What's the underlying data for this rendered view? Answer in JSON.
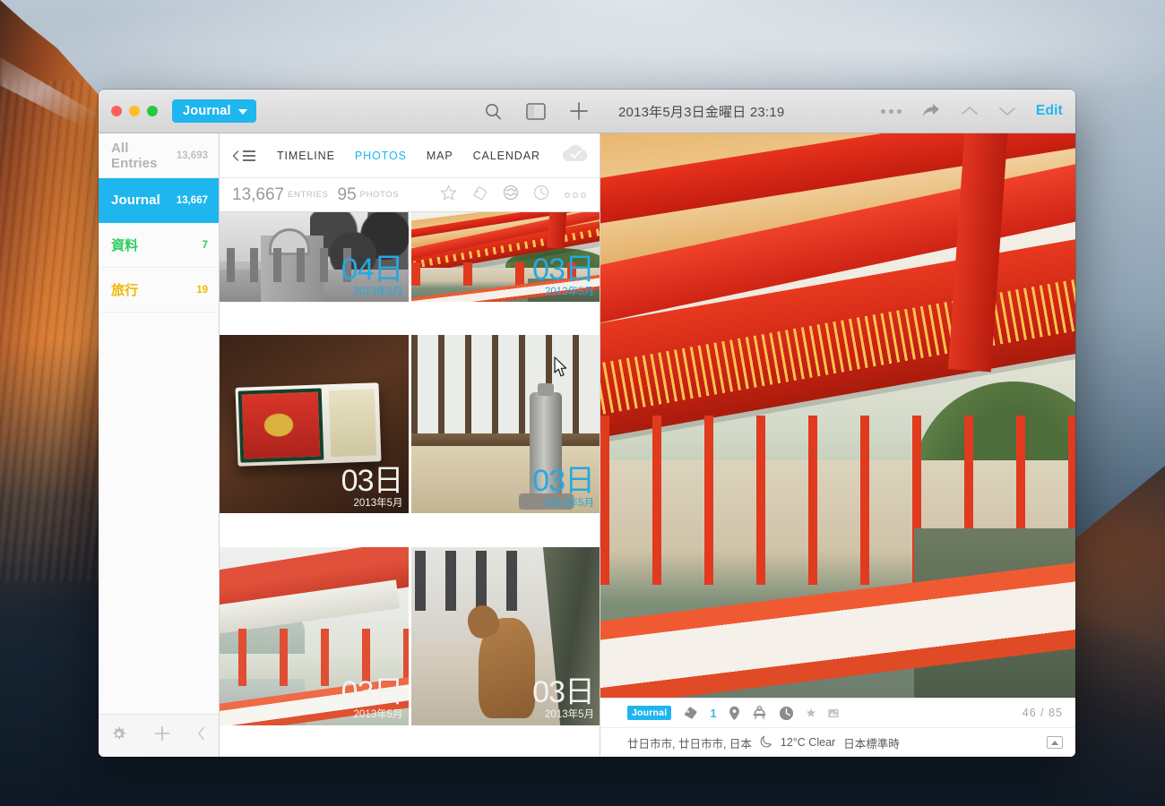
{
  "window": {
    "traffic_lights": [
      "close",
      "minimize",
      "zoom"
    ],
    "journal_selector": "Journal",
    "title": "2013年5月3日金曜日 23:19",
    "toolbar_icons": [
      "search-icon",
      "sidebar-toggle-icon",
      "plus-icon"
    ],
    "right_icons": [
      "more-icon",
      "share-icon",
      "chevron-up-icon",
      "chevron-down-icon"
    ],
    "edit_label": "Edit"
  },
  "sidebar": {
    "items": [
      {
        "label": "All Entries",
        "count": "13,693",
        "style": "all"
      },
      {
        "label": "Journal",
        "count": "13,667",
        "style": "sel"
      },
      {
        "label": "資料",
        "count": "7",
        "style": "green"
      },
      {
        "label": "旅行",
        "count": "19",
        "style": "orange"
      }
    ],
    "footer_icons": [
      "gear-icon",
      "plus-icon",
      "collapse-chevron-icon"
    ]
  },
  "middle": {
    "collapse_icon": "collapse-list-icon",
    "tabs": [
      {
        "label": "TIMELINE",
        "active": false
      },
      {
        "label": "PHOTOS",
        "active": true
      },
      {
        "label": "MAP",
        "active": false
      },
      {
        "label": "CALENDAR",
        "active": false
      }
    ],
    "sync_icon": "cloud-check-icon",
    "counts": {
      "entries_value": "13,667",
      "entries_label": "ENTRIES",
      "photos_value": "95",
      "photos_label": "PHOTOS"
    },
    "filter_icons": [
      "star-icon",
      "tag-icon",
      "globe-icon",
      "clock-icon",
      "more-dots-icon"
    ],
    "thumbnails": [
      {
        "day": "04日",
        "month": "2013年5月",
        "color": "blue",
        "art": "ph-dome",
        "selected": false,
        "cut": true
      },
      {
        "day": "03日",
        "month": "2013年5月",
        "color": "blue",
        "art": "ph-shrine",
        "selected": true,
        "cut": true
      },
      {
        "day": "03日",
        "month": "2013年5月",
        "color": "white",
        "art": "ph-match",
        "selected": false,
        "cut": false
      },
      {
        "day": "03日",
        "month": "2013年5月",
        "color": "blue",
        "art": "ph-hyd",
        "selected": false,
        "cut": false
      },
      {
        "day": "03日",
        "month": "2013年5月",
        "color": "white",
        "art": "ph-shrine2",
        "selected": false,
        "cut": false
      },
      {
        "day": "03日",
        "month": "2013年5月",
        "color": "white",
        "art": "ph-deer",
        "selected": false,
        "cut": false
      }
    ]
  },
  "detail": {
    "journal_badge": "Journal",
    "meta_icons": [
      "tag-icon",
      "location-pin-icon",
      "activity-icon",
      "clock-icon",
      "star-icon",
      "photo-icon"
    ],
    "tag_count": "1",
    "photo_counter": "46  /  85",
    "location": "廿日市市, 廿日市市, 日本",
    "weather_icon": "moon-icon",
    "weather": "12°C Clear",
    "timezone": "日本標準時",
    "expand_icon": "expand-icon"
  },
  "colors": {
    "accent": "#1fb6f0",
    "green": "#2dcc62",
    "orange": "#f3b700",
    "tag_blue": "#3db8e8"
  }
}
